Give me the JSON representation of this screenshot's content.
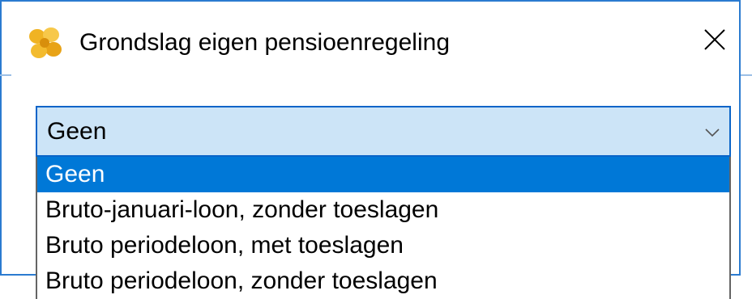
{
  "window": {
    "title": "Grondslag eigen pensioenregeling",
    "icon": "app-flower-icon",
    "close_icon": "close-icon",
    "accent_color": "#2b7bd0"
  },
  "combo": {
    "selected_value": "Geen",
    "arrow_icon": "chevron-down-icon",
    "background": "#cce4f7",
    "border_color": "#0a64c8"
  },
  "dropdown": {
    "highlight_color": "#0078d7",
    "options": [
      "Geen",
      "Bruto-januari-loon, zonder toeslagen",
      "Bruto periodeloon, met toeslagen",
      "Bruto periodeloon, zonder toeslagen"
    ],
    "highlighted_index": 0
  }
}
